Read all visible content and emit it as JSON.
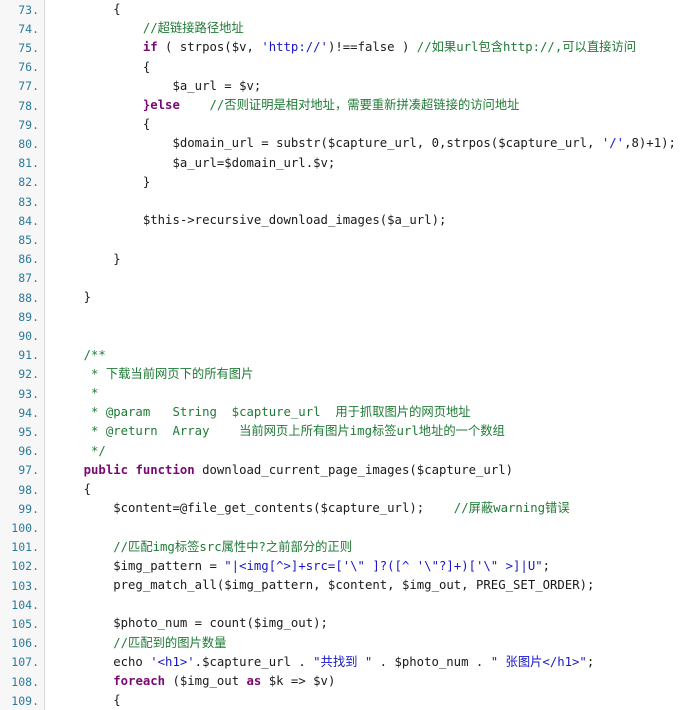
{
  "viewer": {
    "name": "code-viewer",
    "language": "PHP",
    "gutter_background": "#f7f7f7",
    "code_background": "#ffffff",
    "line_number_color": "#2b7a9b",
    "comment_color": "#1f7a36",
    "keyword_color": "#7a0874",
    "string_color": "#1717c8",
    "plain_color": "#1a1a1a",
    "first_line": 73,
    "last_line": 109
  },
  "lines": [
    {
      "number": "73.",
      "tokens": [
        {
          "c": "plain",
          "t": "        {"
        }
      ]
    },
    {
      "number": "74.",
      "tokens": [
        {
          "c": "comment",
          "t": "            //超链接路径地址"
        }
      ]
    },
    {
      "number": "75.",
      "tokens": [
        {
          "c": "plain",
          "t": "            "
        },
        {
          "c": "keyword",
          "t": "if"
        },
        {
          "c": "plain",
          "t": " ( strpos($v, "
        },
        {
          "c": "string",
          "t": "'http://'"
        },
        {
          "c": "plain",
          "t": ")!==false ) "
        },
        {
          "c": "comment",
          "t": "//如果url包含http://,可以直接访问"
        }
      ]
    },
    {
      "number": "76.",
      "tokens": [
        {
          "c": "plain",
          "t": "            {"
        }
      ]
    },
    {
      "number": "77.",
      "tokens": [
        {
          "c": "plain",
          "t": "                $a_url = $v;"
        }
      ]
    },
    {
      "number": "78.",
      "tokens": [
        {
          "c": "plain",
          "t": "            "
        },
        {
          "c": "keyword",
          "t": "}else"
        },
        {
          "c": "plain",
          "t": "    "
        },
        {
          "c": "comment",
          "t": "//否则证明是相对地址，需要重新拼凑超链接的访问地址"
        }
      ]
    },
    {
      "number": "79.",
      "tokens": [
        {
          "c": "plain",
          "t": "            {"
        }
      ]
    },
    {
      "number": "80.",
      "tokens": [
        {
          "c": "plain",
          "t": "                $domain_url = substr($capture_url, 0,strpos($capture_url, "
        },
        {
          "c": "string",
          "t": "'/'"
        },
        {
          "c": "plain",
          "t": ",8)+1);"
        }
      ]
    },
    {
      "number": "81.",
      "tokens": [
        {
          "c": "plain",
          "t": "                $a_url=$domain_url.$v;"
        }
      ]
    },
    {
      "number": "82.",
      "tokens": [
        {
          "c": "plain",
          "t": "            }"
        }
      ]
    },
    {
      "number": "83.",
      "tokens": [
        {
          "c": "plain",
          "t": ""
        }
      ]
    },
    {
      "number": "84.",
      "tokens": [
        {
          "c": "plain",
          "t": "            $this->recursive_download_images($a_url);"
        }
      ]
    },
    {
      "number": "85.",
      "tokens": [
        {
          "c": "plain",
          "t": ""
        }
      ]
    },
    {
      "number": "86.",
      "tokens": [
        {
          "c": "plain",
          "t": "        }"
        }
      ]
    },
    {
      "number": "87.",
      "tokens": [
        {
          "c": "plain",
          "t": ""
        }
      ]
    },
    {
      "number": "88.",
      "tokens": [
        {
          "c": "plain",
          "t": "    }"
        }
      ]
    },
    {
      "number": "89.",
      "tokens": [
        {
          "c": "plain",
          "t": ""
        }
      ]
    },
    {
      "number": "90.",
      "tokens": [
        {
          "c": "plain",
          "t": ""
        }
      ]
    },
    {
      "number": "91.",
      "tokens": [
        {
          "c": "comment",
          "t": "    /**"
        }
      ]
    },
    {
      "number": "92.",
      "tokens": [
        {
          "c": "comment",
          "t": "     * 下载当前网页下的所有图片"
        }
      ]
    },
    {
      "number": "93.",
      "tokens": [
        {
          "c": "comment",
          "t": "     *"
        }
      ]
    },
    {
      "number": "94.",
      "tokens": [
        {
          "c": "comment",
          "t": "     * @param   String  $capture_url  用于抓取图片的网页地址"
        }
      ]
    },
    {
      "number": "95.",
      "tokens": [
        {
          "c": "comment",
          "t": "     * @return  Array    当前网页上所有图片img标签url地址的一个数组"
        }
      ]
    },
    {
      "number": "96.",
      "tokens": [
        {
          "c": "comment",
          "t": "     */"
        }
      ]
    },
    {
      "number": "97.",
      "tokens": [
        {
          "c": "plain",
          "t": "    "
        },
        {
          "c": "keyword",
          "t": "public function"
        },
        {
          "c": "plain",
          "t": " download_current_page_images($capture_url)"
        }
      ]
    },
    {
      "number": "98.",
      "tokens": [
        {
          "c": "plain",
          "t": "    {"
        }
      ]
    },
    {
      "number": "99.",
      "tokens": [
        {
          "c": "plain",
          "t": "        $content=@file_get_contents($capture_url);   "
        },
        {
          "c": "comment",
          "t": " //屏蔽warning错误"
        }
      ]
    },
    {
      "number": "100.",
      "tokens": [
        {
          "c": "plain",
          "t": ""
        }
      ]
    },
    {
      "number": "101.",
      "tokens": [
        {
          "c": "comment",
          "t": "        //匹配img标签src属性中?之前部分的正则"
        }
      ]
    },
    {
      "number": "102.",
      "tokens": [
        {
          "c": "plain",
          "t": "        $img_pattern = "
        },
        {
          "c": "string",
          "t": "\"|<img[^>]+src=['\\\" ]?([^ '\\\"?]+)['\\\" >]|U\""
        },
        {
          "c": "plain",
          "t": ";"
        }
      ]
    },
    {
      "number": "103.",
      "tokens": [
        {
          "c": "plain",
          "t": "        preg_match_all($img_pattern, $content, $img_out, PREG_SET_ORDER);"
        }
      ]
    },
    {
      "number": "104.",
      "tokens": [
        {
          "c": "plain",
          "t": ""
        }
      ]
    },
    {
      "number": "105.",
      "tokens": [
        {
          "c": "plain",
          "t": "        $photo_num = count($img_out);"
        }
      ]
    },
    {
      "number": "106.",
      "tokens": [
        {
          "c": "comment",
          "t": "        //匹配到的图片数量"
        }
      ]
    },
    {
      "number": "107.",
      "tokens": [
        {
          "c": "plain",
          "t": "        echo "
        },
        {
          "c": "string",
          "t": "'<h1>'"
        },
        {
          "c": "plain",
          "t": ".$capture_url . "
        },
        {
          "c": "string",
          "t": "\"共找到 \""
        },
        {
          "c": "plain",
          "t": " . $photo_num . "
        },
        {
          "c": "string",
          "t": "\" 张图片</h1>\""
        },
        {
          "c": "plain",
          "t": ";"
        }
      ]
    },
    {
      "number": "108.",
      "tokens": [
        {
          "c": "plain",
          "t": "        "
        },
        {
          "c": "keyword",
          "t": "foreach"
        },
        {
          "c": "plain",
          "t": " ($img_out "
        },
        {
          "c": "keyword",
          "t": "as"
        },
        {
          "c": "plain",
          "t": " $k => $v)"
        }
      ]
    },
    {
      "number": "109.",
      "tokens": [
        {
          "c": "plain",
          "t": "        {"
        }
      ]
    }
  ]
}
